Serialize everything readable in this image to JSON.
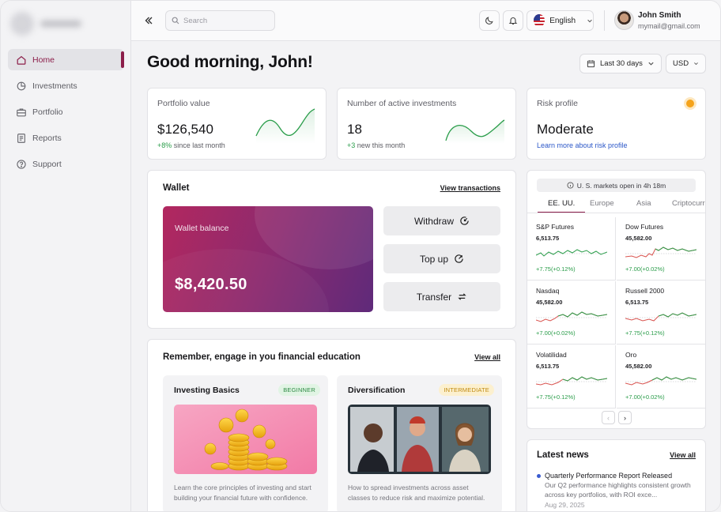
{
  "sidebar": {
    "items": [
      {
        "label": "Home",
        "icon": "home-icon",
        "active": true
      },
      {
        "label": "Investments",
        "icon": "pie-chart-icon"
      },
      {
        "label": "Portfolio",
        "icon": "briefcase-icon"
      },
      {
        "label": "Reports",
        "icon": "report-icon"
      },
      {
        "label": "Support",
        "icon": "help-icon"
      }
    ],
    "accent": "#8c1e4a"
  },
  "topbar": {
    "search_placeholder": "Search",
    "language": "English",
    "user_name": "John Smith",
    "user_email": "mymail@gmail.com"
  },
  "greeting": "Good morning, John!",
  "filters": {
    "range": "Last 30 days",
    "currency": "USD"
  },
  "stats": [
    {
      "title": "Portfolio value",
      "value": "$126,540",
      "change": "+8%",
      "change_text": "since last month"
    },
    {
      "title": "Number of active investments",
      "value": "18",
      "change": "+3",
      "change_text": "new this month"
    }
  ],
  "risk": {
    "title": "Risk profile",
    "value": "Moderate",
    "link": "Learn more about risk profile",
    "color": "#f5a31a"
  },
  "wallet": {
    "title": "Wallet",
    "link": "View transactions",
    "balance_label": "Wallet balance",
    "balance": "$8,420.50",
    "actions": [
      "Withdraw",
      "Top up",
      "Transfer"
    ]
  },
  "education": {
    "title": "Remember, engage in you financial education",
    "link": "View all",
    "items": [
      {
        "title": "Investing Basics",
        "badge": "BEGINNER",
        "desc": "Learn the core principles of investing and start building your financial future with confidence."
      },
      {
        "title": "Diversification",
        "badge": "INTERMEDIATE",
        "desc": "How to spread investments across asset classes to reduce risk and maximize potential."
      }
    ]
  },
  "markets": {
    "status": "U. S. markets open in 4h 18m",
    "tabs": [
      "EE. UU.",
      "Europe",
      "Asia",
      "Criptocurrency"
    ],
    "items": [
      {
        "name": "S&P Futures",
        "value": "6,513.75",
        "change": "+7.75(+0.12%)"
      },
      {
        "name": "Dow Futures",
        "value": "45,582.00",
        "change": "+7.00(+0.02%)"
      },
      {
        "name": "Nasdaq",
        "value": "45,582.00",
        "change": "+7.00(+0.02%)"
      },
      {
        "name": "Russell 2000",
        "value": "6,513.75",
        "change": "+7.75(+0.12%)"
      },
      {
        "name": "Volatilidad",
        "value": "6,513.75",
        "change": "+7.75(+0.12%)"
      },
      {
        "name": "Oro",
        "value": "45,582.00",
        "change": "+7.00(+0.02%)"
      }
    ]
  },
  "news": {
    "title": "Latest news",
    "link": "View all",
    "items": [
      {
        "headline": "Quarterly Performance Report Released",
        "summary": "Our Q2 performance highlights consistent growth across key portfolios, with ROI exce...",
        "date": "Aug 29, 2025"
      }
    ]
  }
}
